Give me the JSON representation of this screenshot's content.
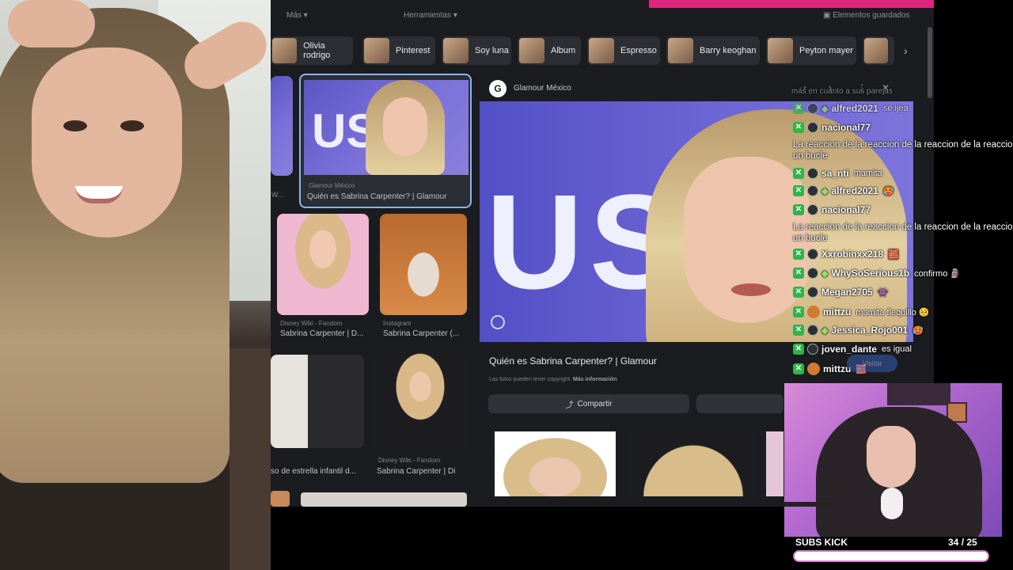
{
  "topnav": {
    "more": "Más",
    "tools": "Herramientas",
    "saved": "Elementos guardados"
  },
  "chips": [
    {
      "label": "Olivia rodrigo"
    },
    {
      "label": "Pinterest"
    },
    {
      "label": "Soy luna"
    },
    {
      "label": "Album"
    },
    {
      "label": "Espresso"
    },
    {
      "label": "Barry keoghan"
    },
    {
      "label": "Peyton mayer"
    }
  ],
  "grid": {
    "selected": {
      "source": "Glamour México",
      "caption": "Quién es Sabrina Carpenter? | Glamour"
    },
    "r2a": {
      "source": "Disney Wiki - Fandom",
      "caption": "Sabrina Carpenter | D..."
    },
    "r2b": {
      "source": "Instagram",
      "caption": "Sabrina Carpenter (..."
    },
    "r3a": {
      "caption": "so de estrella infantil d..."
    },
    "r3b": {
      "source": "Disney Wiki - Fandom",
      "caption": "Sabrina Carpenter | Di"
    }
  },
  "detail": {
    "source": "Glamour México",
    "logo_letter": "G",
    "hero_text": "US",
    "title": "Quién es Sabrina Carpenter? | Glamour",
    "note": "Las fotos pueden tener copyright.",
    "note_link": "Más información",
    "share_label": "Compartir",
    "visit_label": "Visitar"
  },
  "chat": {
    "header_fragment": "más en cuanto a sus parejas",
    "lines": [
      {
        "type": "msg",
        "user": "alfred2021",
        "msg": "se ijea",
        "badges": [
          "mod",
          "user",
          "gem"
        ]
      },
      {
        "type": "user",
        "user": "nacional77",
        "badges": [
          "mod",
          "user"
        ]
      },
      {
        "type": "text",
        "msg": "La reaccion de la reaccion de la reaccion de la reaccion un bucle"
      },
      {
        "type": "msg",
        "user": "sa_nti",
        "msg": "mamita",
        "badges": [
          "mod",
          "user"
        ]
      },
      {
        "type": "msg",
        "user": "alfred2021",
        "msg": "🥵",
        "badges": [
          "mod",
          "user",
          "gem"
        ]
      },
      {
        "type": "user",
        "user": "nacional77",
        "badges": [
          "mod",
          "user"
        ]
      },
      {
        "type": "text",
        "msg": "La reaccion de la reaccion de la reaccion de la reaccion un bucle"
      },
      {
        "type": "msg",
        "user": "Xxrobinxx218",
        "msg": "🧱",
        "badges": [
          "mod",
          "user"
        ]
      },
      {
        "type": "msg",
        "user": "WhySoSerious1b",
        "msg": "confirmo 🗿",
        "badges": [
          "mod",
          "user",
          "gem"
        ]
      },
      {
        "type": "msg",
        "user": "Megan2705",
        "msg": "👾",
        "badges": [
          "mod",
          "user"
        ]
      },
      {
        "type": "msg",
        "user": "mittzu",
        "msg": "mamita flequillo 🥺",
        "badges": [
          "mod",
          "avatar"
        ]
      },
      {
        "type": "msg",
        "user": "Jessica_Rojo001",
        "msg": "🥵",
        "badges": [
          "mod",
          "user",
          "gem"
        ]
      },
      {
        "type": "msg",
        "user": "joven_dante",
        "msg": "es igual",
        "badges": [
          "mod",
          "user"
        ]
      },
      {
        "type": "msg",
        "user": "mittzu",
        "msg": "🧱",
        "badges": [
          "mod",
          "avatar"
        ]
      }
    ]
  },
  "subs": {
    "label": "SUBS KICK",
    "current": "34",
    "goal": "/ 25",
    "fraction": 1.0
  },
  "colors": {
    "accent": "#e0257e",
    "mod_badge": "#2fb34a",
    "gem": "#8be36a"
  }
}
